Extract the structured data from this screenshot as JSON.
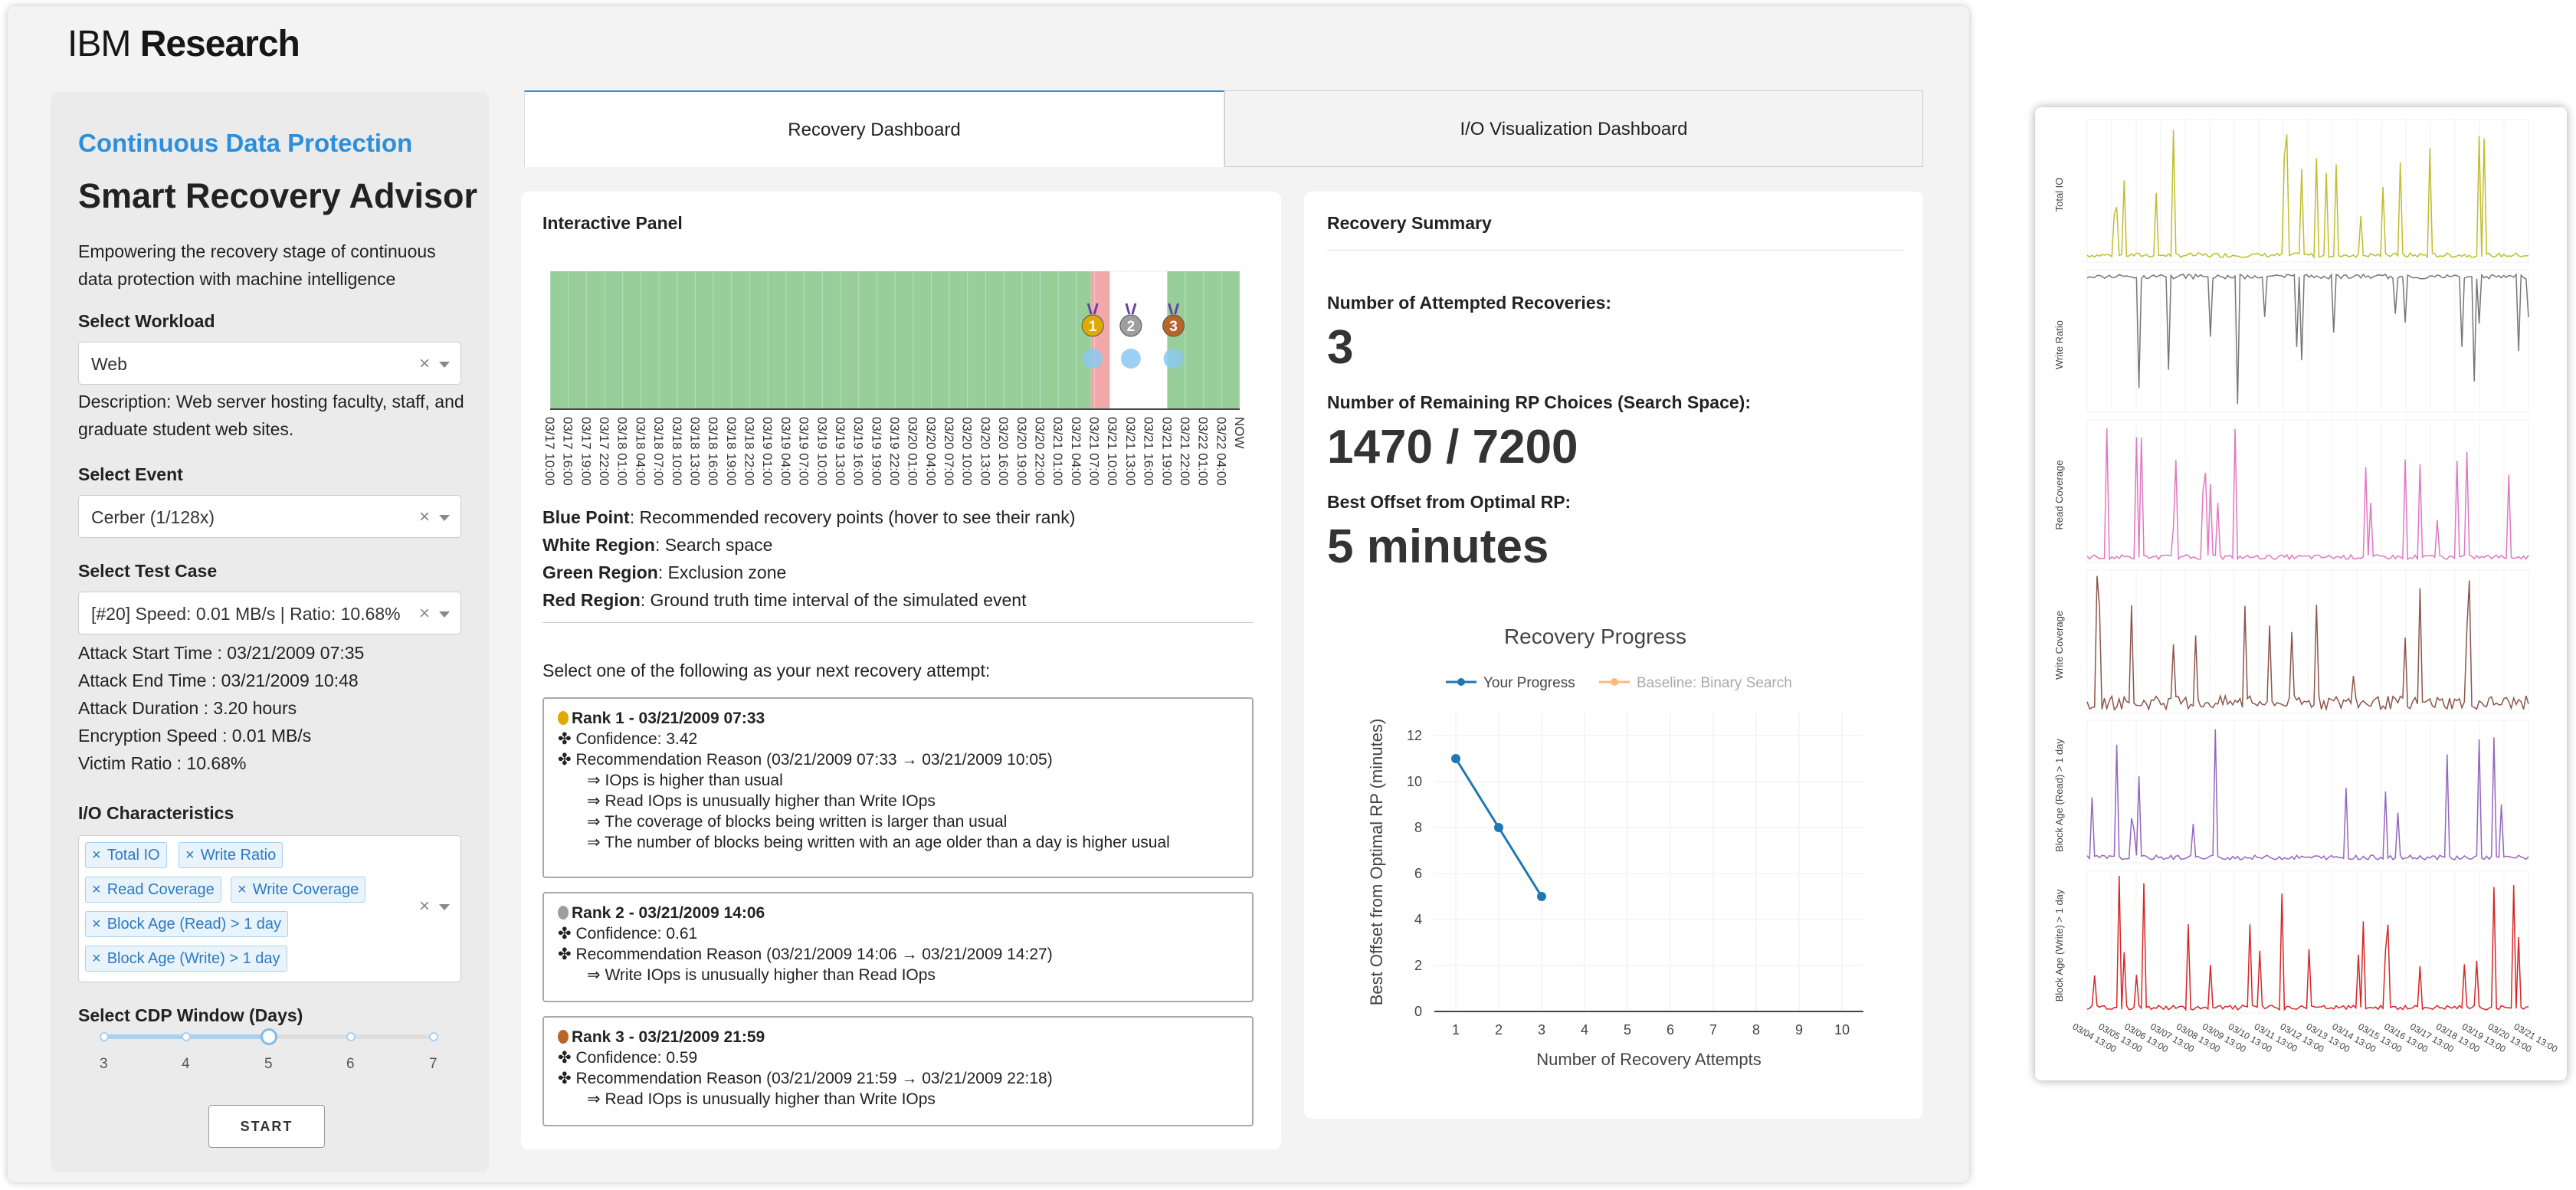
{
  "brand": {
    "thin": "IBM",
    "bold": "Research"
  },
  "sidebar": {
    "title": "Continuous Data Protection",
    "heading": "Smart Recovery Advisor",
    "description": "Empowering the recovery stage of continuous data protection with machine intelligence",
    "workload": {
      "label": "Select Workload",
      "value": "Web",
      "description": "Description: Web server hosting faculty, staff, and graduate student web sites."
    },
    "event": {
      "label": "Select Event",
      "value": "Cerber (1/128x)"
    },
    "test_case": {
      "label": "Select Test Case",
      "value": "[#20] Speed: 0.01 MB/s | Ratio: 10.68%"
    },
    "attack_info": [
      "Attack Start Time : 03/21/2009 07:35",
      "Attack End Time : 03/21/2009 10:48",
      "Attack Duration : 3.20 hours",
      "Encryption Speed : 0.01 MB/s",
      "Victim Ratio : 10.68%"
    ],
    "io": {
      "label": "I/O Characteristics",
      "tags": [
        "Total IO",
        "Write Ratio",
        "Read Coverage",
        "Write Coverage",
        "Block Age (Read) > 1 day",
        "Block Age (Write) > 1 day"
      ]
    },
    "cdp": {
      "label": "Select CDP Window (Days)",
      "ticks": [
        "3",
        "4",
        "5",
        "6",
        "7"
      ],
      "value": 5,
      "min": 3,
      "max": 7
    },
    "start_label": "START",
    "clear_symbol": "×",
    "tag_remove_symbol": "×"
  },
  "tabs": [
    "Recovery Dashboard",
    "I/O Visualization Dashboard"
  ],
  "interactive": {
    "title": "Interactive Panel",
    "timeline_labels": [
      "03/17 10:00",
      "03/17 16:00",
      "03/17 19:00",
      "03/17 22:00",
      "03/18 01:00",
      "03/18 04:00",
      "03/18 07:00",
      "03/18 10:00",
      "03/18 13:00",
      "03/18 16:00",
      "03/18 19:00",
      "03/18 22:00",
      "03/19 01:00",
      "03/19 04:00",
      "03/19 07:00",
      "03/19 10:00",
      "03/19 13:00",
      "03/19 16:00",
      "03/19 19:00",
      "03/19 22:00",
      "03/20 01:00",
      "03/20 04:00",
      "03/20 07:00",
      "03/20 10:00",
      "03/20 13:00",
      "03/20 16:00",
      "03/20 19:00",
      "03/20 22:00",
      "03/21 01:00",
      "03/21 04:00",
      "03/21 07:00",
      "03/21 10:00",
      "03/21 13:00",
      "03/21 16:00",
      "03/21 19:00",
      "03/21 22:00",
      "03/22 01:00",
      "03/22 04:00",
      "NOW"
    ],
    "legend": [
      {
        "term": "Blue Point",
        "desc": ": Recommended recovery points (hover to see their rank)"
      },
      {
        "term": "White Region",
        "desc": ": Search space"
      },
      {
        "term": "Green Region",
        "desc": ": Exclusion zone"
      },
      {
        "term": "Red Region",
        "desc": ": Ground truth time interval of the simulated event"
      }
    ],
    "prompt": "Select one of the following as your next recovery attempt:",
    "recommendations": [
      {
        "title": "Rank 1 - 03/21/2009 07:33",
        "confidence": "Confidence: 3.42",
        "reason": "Recommendation Reason (03/21/2009 07:33 → 03/21/2009 10:05)",
        "bullets": [
          "IOps is higher than usual",
          "Read IOps is unusually higher than Write IOps",
          "The coverage of blocks being written is larger than usual",
          "The number of blocks being written with an age older than a day is higher usual"
        ],
        "medal_color": "#e0a800"
      },
      {
        "title": "Rank 2 - 03/21/2009 14:06",
        "confidence": "Confidence: 0.61",
        "reason": "Recommendation Reason (03/21/2009 14:06 → 03/21/2009 14:27)",
        "bullets": [
          "Write IOps is unusually higher than Read IOps"
        ],
        "medal_color": "#9e9e9e"
      },
      {
        "title": "Rank 3 - 03/21/2009 21:59",
        "confidence": "Confidence: 0.59",
        "reason": "Recommendation Reason (03/21/2009 21:59 → 03/21/2009 22:18)",
        "bullets": [
          "Read IOps is unusually higher than Write IOps"
        ],
        "medal_color": "#b8652b"
      }
    ],
    "rank_markers": [
      "1",
      "2",
      "3"
    ],
    "colors": {
      "green": "#98ce9a",
      "red": "#f4a7a9",
      "blue": "#8cc8f0"
    }
  },
  "summary": {
    "title": "Recovery Summary",
    "attempted_label": "Number of Attempted Recoveries:",
    "attempted_value": "3",
    "remaining_label": "Number of Remaining RP Choices (Search Space):",
    "remaining_value": "1470 / 7200",
    "offset_label": "Best Offset from Optimal RP:",
    "offset_value": "5 minutes"
  },
  "chart_data": [
    {
      "type": "line",
      "title": "Recovery Progress",
      "xlabel": "Number of Recovery Attempts",
      "ylabel": "Best Offset from Optimal RP (minutes)",
      "x_ticks": [
        1,
        2,
        3,
        4,
        5,
        6,
        7,
        8,
        9,
        10
      ],
      "y_ticks": [
        0,
        2,
        4,
        6,
        8,
        10,
        12
      ],
      "xlim": [
        0.5,
        10.5
      ],
      "ylim": [
        0,
        13
      ],
      "grid": true,
      "legend_position": "top",
      "series": [
        {
          "name": "Your Progress",
          "x": [
            1,
            2,
            3
          ],
          "y": [
            11,
            8,
            5
          ],
          "color": "#1f77b4"
        },
        {
          "name": "Baseline: Binary Search",
          "x": [],
          "y": [],
          "color": "#ffb97a"
        }
      ]
    },
    {
      "type": "line",
      "series": [
        {
          "name": "Total IO",
          "color": "#c0bd2e"
        },
        {
          "name": "Write Ratio",
          "color": "#777777"
        },
        {
          "name": "Read Coverage",
          "color": "#e277c3"
        },
        {
          "name": "Write Coverage",
          "color": "#8c564b"
        },
        {
          "name": "Block Age (Read) > 1 day",
          "color": "#9467bd"
        },
        {
          "name": "Block Age (Write) > 1 day",
          "color": "#d62728"
        }
      ],
      "x_ticks": [
        "03/04 13:00",
        "03/05 13:00",
        "03/06 13:00",
        "03/07 13:00",
        "03/08 13:00",
        "03/09 13:00",
        "03/10 13:00",
        "03/11 13:00",
        "03/12 13:00",
        "03/13 13:00",
        "03/14 13:00",
        "03/15 13:00",
        "03/16 13:00",
        "03/17 13:00",
        "03/18 13:00",
        "03/19 13:00",
        "03/20 13:00",
        "03/21 13:00"
      ],
      "grid": true
    }
  ]
}
